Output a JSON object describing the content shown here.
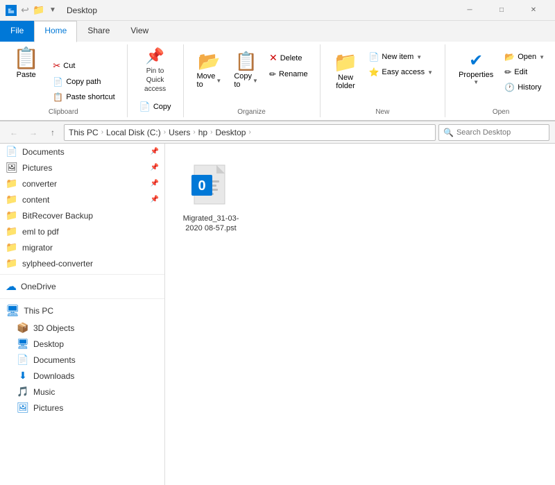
{
  "titleBar": {
    "title": "Desktop",
    "quickAccessIcons": [
      "📌",
      "✔",
      "📁",
      "▼"
    ]
  },
  "ribbonTabs": [
    {
      "label": "File",
      "active": false,
      "isFile": true
    },
    {
      "label": "Home",
      "active": true,
      "isFile": false
    },
    {
      "label": "Share",
      "active": false,
      "isFile": false
    },
    {
      "label": "View",
      "active": false,
      "isFile": false
    }
  ],
  "ribbon": {
    "clipboard": {
      "groupLabel": "Clipboard",
      "pasteLabel": "Paste",
      "cutLabel": "Cut",
      "copyLabel": "Copy",
      "copyPathLabel": "Copy path",
      "pasteShortcutLabel": "Paste shortcut"
    },
    "organize": {
      "groupLabel": "Organize",
      "moveToLabel": "Move to",
      "copyToLabel": "Copy to",
      "deleteLabel": "Delete",
      "renameLabel": "Rename"
    },
    "new": {
      "groupLabel": "New",
      "newFolderLabel": "New folder",
      "newItemLabel": "New item",
      "easyAccessLabel": "Easy access"
    },
    "open": {
      "groupLabel": "Open",
      "propertiesLabel": "Properties",
      "openLabel": "Open",
      "editLabel": "Edit",
      "historyLabel": "History"
    }
  },
  "addressBar": {
    "path": [
      "This PC",
      "Local Disk (C:)",
      "Users",
      "hp",
      "Desktop"
    ],
    "searchPlaceholder": "Search Desktop"
  },
  "sidebar": {
    "pinnedItems": [
      {
        "label": "Documents",
        "icon": "📄",
        "pinned": true
      },
      {
        "label": "Pictures",
        "icon": "🖼",
        "pinned": true
      },
      {
        "label": "converter",
        "icon": "📁",
        "pinned": true
      },
      {
        "label": "content",
        "icon": "📁",
        "pinned": true
      }
    ],
    "folderItems": [
      {
        "label": "BitRecover Backup",
        "icon": "📁"
      },
      {
        "label": "eml to pdf",
        "icon": "📁"
      },
      {
        "label": "migrator",
        "icon": "📁"
      },
      {
        "label": "sylpheed-converter",
        "icon": "📁"
      }
    ],
    "oneDrive": {
      "label": "OneDrive",
      "icon": "☁"
    },
    "thisPC": {
      "label": "This PC",
      "icon": "💻",
      "children": [
        {
          "label": "3D Objects",
          "icon": "📦"
        },
        {
          "label": "Desktop",
          "icon": "🖥"
        },
        {
          "label": "Documents",
          "icon": "📄"
        },
        {
          "label": "Downloads",
          "icon": "⬇"
        },
        {
          "label": "Music",
          "icon": "🎵"
        },
        {
          "label": "Pictures",
          "icon": "🖼"
        }
      ]
    }
  },
  "content": {
    "files": [
      {
        "name": "Migrated_31-03-2020 08-57.pst",
        "icon": "pst",
        "badge": "0"
      }
    ]
  }
}
